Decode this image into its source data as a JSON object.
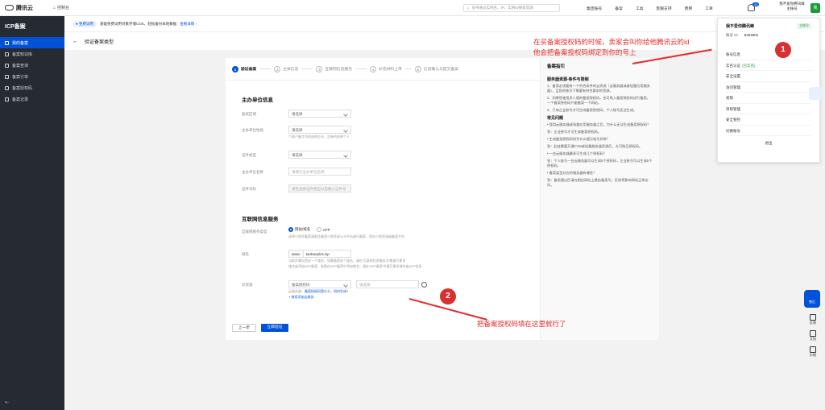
{
  "topbar": {
    "brand": "腾讯云",
    "console": "控制台",
    "search_placeholder": "支持通过实例名、IP、实例ID搜索资源",
    "nav": [
      "集团账号",
      "备案",
      "工具",
      "客服支持",
      "费用",
      "工单"
    ],
    "notif_count": "26",
    "user_name": "我不爱你腾讯峰",
    "user_role": "主账号",
    "avatar": "我"
  },
  "sidebar": {
    "title": "ICP备案",
    "items": [
      {
        "label": "我的备案",
        "active": true
      },
      {
        "label": "备案知识库",
        "active": false
      },
      {
        "label": "备案查询",
        "active": false
      },
      {
        "label": "备案订单",
        "active": false
      },
      {
        "label": "备案授权码",
        "active": false
      },
      {
        "label": "备案记录",
        "active": false
      }
    ],
    "collapse": "⇤"
  },
  "notice": {
    "tag": "● 免费试用",
    "text": "基础免费试用对象存储COS，轻松备份本地数据",
    "link": "查看详情 ›"
  },
  "page": {
    "title": "验证备案类型"
  },
  "steps": [
    {
      "num": "1",
      "label": "验证备案",
      "active": true
    },
    {
      "num": "2",
      "label": "主体信息",
      "active": false
    },
    {
      "num": "3",
      "label": "互联网信息服务",
      "active": false
    },
    {
      "num": "4",
      "label": "补充材料上传",
      "active": false
    },
    {
      "num": "5",
      "label": "信息确认与提交备案",
      "active": false
    }
  ],
  "form": {
    "section1": "主办单位信息",
    "province_label": "备案区域",
    "province_value": "请选择",
    "nature_label": "主办单位性质",
    "nature_value": "请选择",
    "nature_hint": "个体户备字号的选择企业，没有的选择个人",
    "cert_type_label": "证件类型",
    "cert_type_value": "请选择",
    "cert_name_label": "主办单位名称",
    "cert_name_placeholder": "请填写主办单位名称",
    "cert_no_label": "证件号码",
    "cert_no_placeholder": "请先选择证件类型以后输入证件号",
    "section2": "互联网信息服务",
    "service_type_label": "互联网服务类型",
    "radio_web": "网站/域名",
    "radio_app": "APP",
    "service_hint": "选择小程序备案请前往备案小程序或公众平台进行备案，再在小程序请留备案平台",
    "domain_label": "域名",
    "domain_prefix": "www.",
    "domain_value": "taobaoplus.vip",
    "domain_hint": "当前步骤仅验证一个域名，如需备案多个域名，请在'互联网信息服务'步骤填写更多",
    "domain_hint2": "域名或添加APP备案，若要在APP备案中添加域名，请在'APP备案'中填写更多域名或APP信息",
    "cloud_label": "云资源",
    "cloud_select": "备案授权码",
    "cloud_input_placeholder": "请选择",
    "cloud_hint_prefix": "云服务器：",
    "cloud_hint_link": "备案授权码是什么，如何生成?",
    "cloud_add": "+ 继续添加云服务",
    "prev": "上一步",
    "next": "立即验证"
  },
  "guide": {
    "title": "备案指引",
    "h1": "服务器资源-条件与限制",
    "p1": "1、备案必须要有一个符合条件的云资源（云服务器或者轻量应用服务器），且您的账号下需要有符合要求的资源。",
    "p2": "2、如果您使用多人版的备案授权码，也可购入备案授权码进行备案，一个备案授权码只能备案一个网站。",
    "p3": "3、只有企业账号才可生成备案授权码，个人账号无法生成。",
    "h2": "常见问题",
    "q1": "• 我用云服务器或轻量应用服务器之后，为什么无法生成备案授权码？",
    "a1": "答：企业账号才可生成备案授权码。",
    "q2": "• 生成备案授权码时为什么提示账号异常？",
    "a2": "答：此处需要开通CVM或轻量服务器资源后，方可购买授权码。",
    "q3": "• 一台云服务器最多可生成几个授权码？",
    "a3": "答：个人账号一台云服务器可以生成5个授权码，企业账号可以生成5个授权码。",
    "q4": "• 备案类型对应的服务器有哪些？",
    "a4": "答：备案通过后请在相应网站上悬挂备案号，否则将影响网站正常访问。"
  },
  "dropdown": {
    "name": "我不爱你腾讯峰",
    "role": "主账号",
    "id_label": "账号 ID",
    "id_value": "5424001",
    "items": [
      "账号信息",
      "实名认证",
      "安全设置",
      "访问管理",
      "权限",
      "项目管理",
      "安全管控"
    ],
    "verified": "(已实名)",
    "switch": "切换账号",
    "logout": "退出"
  },
  "annotations": {
    "note1_line1": "在买备案授权码的时候，卖家会叫你给他腾讯云的id",
    "note1_line2": "他会把备案授权码绑定到你的号上",
    "circle1": "1",
    "circle2": "2",
    "note2": "把备案授权码填在这里就行了"
  },
  "floats": {
    "service": "售后",
    "items": [
      "反馈",
      "文档",
      "价格"
    ]
  }
}
